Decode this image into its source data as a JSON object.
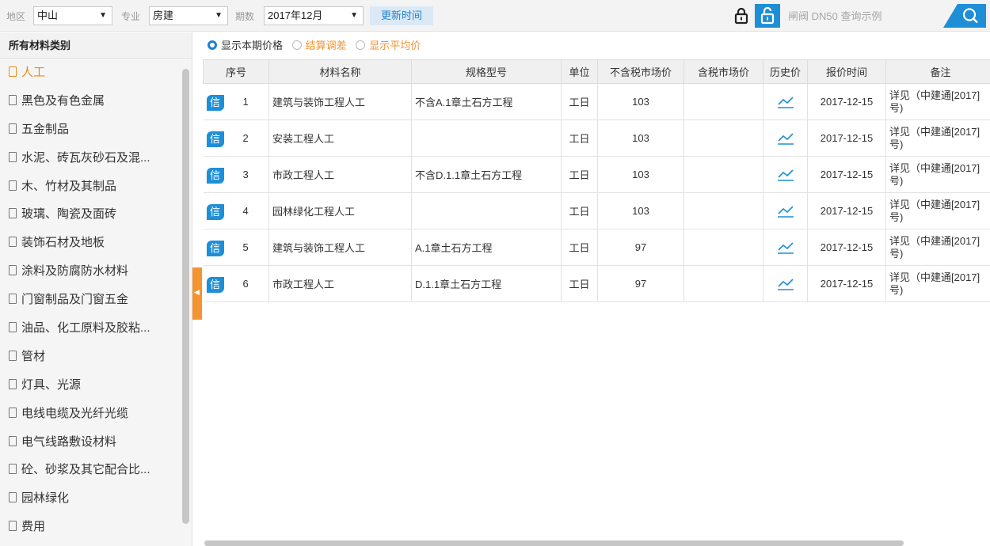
{
  "toolbar": {
    "region_label": "地区",
    "region_value": "中山",
    "major_label": "专业",
    "major_value": "房建",
    "period_label": "期数",
    "period_value": "2017年12月",
    "update_label": "更新时间",
    "search_placeholder": "闸阀 DN50 查询示例"
  },
  "sidebar": {
    "title": "所有材料类别",
    "items": [
      {
        "label": "人工"
      },
      {
        "label": "黑色及有色金属"
      },
      {
        "label": "五金制品"
      },
      {
        "label": "水泥、砖瓦灰砂石及混..."
      },
      {
        "label": "木、竹材及其制品"
      },
      {
        "label": "玻璃、陶瓷及面砖"
      },
      {
        "label": "装饰石材及地板"
      },
      {
        "label": "涂料及防腐防水材料"
      },
      {
        "label": "门窗制品及门窗五金"
      },
      {
        "label": "油品、化工原料及胶粘..."
      },
      {
        "label": "管材"
      },
      {
        "label": "灯具、光源"
      },
      {
        "label": "电线电缆及光纤光缆"
      },
      {
        "label": "电气线路敷设材料"
      },
      {
        "label": "砼、砂浆及其它配合比..."
      },
      {
        "label": "园林绿化"
      },
      {
        "label": "费用"
      }
    ]
  },
  "filters": {
    "show_current": "显示本期价格",
    "settlement": "结算调差",
    "show_average": "显示平均价"
  },
  "table": {
    "headers": [
      "序号",
      "材料名称",
      "规格型号",
      "单位",
      "不含税市场价",
      "含税市场价",
      "历史价",
      "报价时间",
      "备注"
    ],
    "badge": "信",
    "rows": [
      {
        "seq": "1",
        "name": "建筑与装饰工程人工",
        "spec": "不含A.1章土石方工程",
        "unit": "工日",
        "price": "103",
        "tax_price": "",
        "date": "2017-12-15",
        "remark1": "详见（中建通[2017]",
        "remark2": "号)"
      },
      {
        "seq": "2",
        "name": "安装工程人工",
        "spec": "",
        "unit": "工日",
        "price": "103",
        "tax_price": "",
        "date": "2017-12-15",
        "remark1": "详见（中建通[2017]",
        "remark2": "号)"
      },
      {
        "seq": "3",
        "name": "市政工程人工",
        "spec": "不含D.1.1章土石方工程",
        "unit": "工日",
        "price": "103",
        "tax_price": "",
        "date": "2017-12-15",
        "remark1": "详见（中建通[2017]",
        "remark2": "号)"
      },
      {
        "seq": "4",
        "name": "园林绿化工程人工",
        "spec": "",
        "unit": "工日",
        "price": "103",
        "tax_price": "",
        "date": "2017-12-15",
        "remark1": "详见（中建通[2017]",
        "remark2": "号)"
      },
      {
        "seq": "5",
        "name": "建筑与装饰工程人工",
        "spec": "A.1章土石方工程",
        "unit": "工日",
        "price": "97",
        "tax_price": "",
        "date": "2017-12-15",
        "remark1": "详见（中建通[2017]",
        "remark2": "号)"
      },
      {
        "seq": "6",
        "name": "市政工程人工",
        "spec": "D.1.1章土石方工程",
        "unit": "工日",
        "price": "97",
        "tax_price": "",
        "date": "2017-12-15",
        "remark1": "详见（中建通[2017]",
        "remark2": "号)"
      }
    ]
  },
  "colors": {
    "accent": "#1e8fd6",
    "active": "#e98a1f"
  }
}
